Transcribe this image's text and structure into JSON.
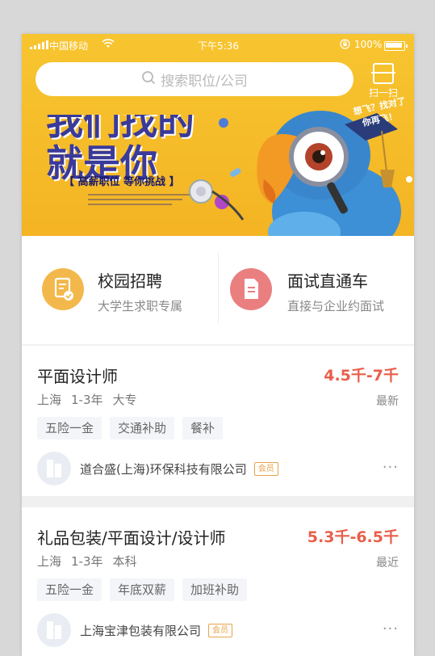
{
  "status_bar": {
    "carrier": "中国移动",
    "time": "下午5:36",
    "battery": "100%"
  },
  "search": {
    "placeholder": "搜索职位/公司",
    "scan_label": "扫一扫"
  },
  "banner": {
    "slogan_line1": "我们找的",
    "slogan_line2": "就是你",
    "tagline": "【 高薪职位  等你挑战 】",
    "bubble_line1": "想飞？找对了",
    "bubble_line2": "你再飞！"
  },
  "quick_entries": [
    {
      "title": "校园招聘",
      "subtitle": "大学生求职专属",
      "icon": "campus-doc-icon",
      "color": "#f3b84b"
    },
    {
      "title": "面试直通车",
      "subtitle": "直接与企业约面试",
      "icon": "interview-doc-icon",
      "color": "#ea7f80"
    }
  ],
  "jobs": [
    {
      "title": "平面设计师",
      "salary": "4.5千-7千",
      "city": "上海",
      "experience": "1-3年",
      "education": "大专",
      "flag": "最新",
      "tags": [
        "五险一金",
        "交通补助",
        "餐补"
      ],
      "company": "道合盛(上海)环保科技有限公司",
      "badge": "会员",
      "more": "···"
    },
    {
      "title": "礼品包装/平面设计/设计师",
      "salary": "5.3千-6.5千",
      "city": "上海",
      "experience": "1-3年",
      "education": "本科",
      "flag": "最近",
      "tags": [
        "五险一金",
        "年底双薪",
        "加班补助"
      ],
      "company": "上海宝津包装有限公司",
      "badge": "会员",
      "more": "···"
    }
  ],
  "colors": {
    "banner": "#f4b423",
    "salary": "#e95e4a",
    "member_badge": "#e8a34a"
  }
}
